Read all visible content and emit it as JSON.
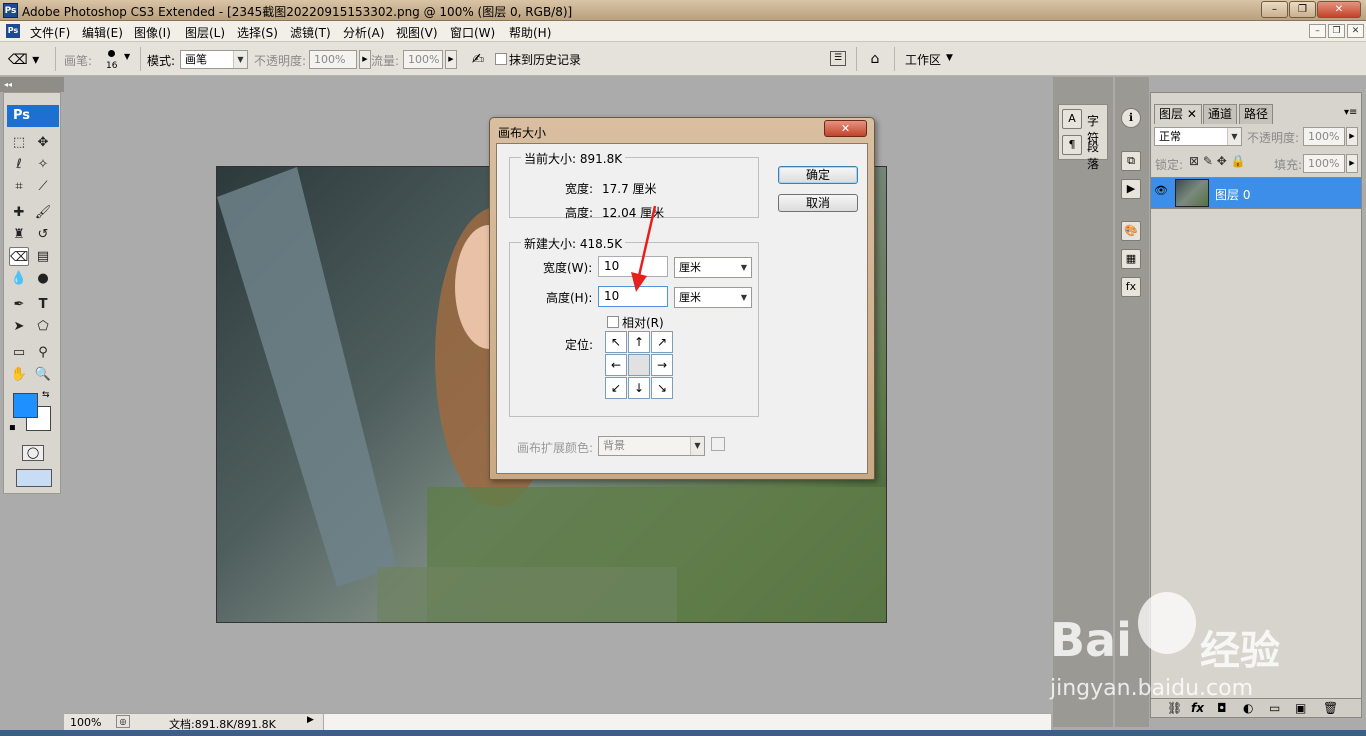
{
  "window": {
    "app_icon": "Ps",
    "title": "Adobe Photoshop CS3 Extended - [2345截图20220915153302.png @ 100% (图层 0, RGB/8)]",
    "controls": [
      "–",
      "❐",
      "✕"
    ]
  },
  "menubar": {
    "logo": "Ps",
    "items": [
      "文件(F)",
      "编辑(E)",
      "图像(I)",
      "图层(L)",
      "选择(S)",
      "滤镜(T)",
      "分析(A)",
      "视图(V)",
      "窗口(W)",
      "帮助(H)"
    ],
    "doc_controls": [
      "–",
      "❐",
      "✕"
    ]
  },
  "options": {
    "brush_label": "画笔:",
    "brush_size": "16",
    "mode_label": "模式:",
    "mode_value": "画笔",
    "opacity_label": "不透明度:",
    "opacity_value": "100%",
    "flow_label": "流量:",
    "flow_value": "100%",
    "erase_history_label": "抹到历史记录",
    "workspace_label": "工作区"
  },
  "toolbox": {
    "logo": "Ps",
    "foreground_color": "#1e90ff",
    "background_color": "#ffffff"
  },
  "status": {
    "zoom": "100%",
    "doc_info": "文档:891.8K/891.8K"
  },
  "dialog": {
    "title": "画布大小",
    "close": "✕",
    "current_size_label": "当前大小: 891.8K",
    "current_width_label": "宽度:",
    "current_width_value": "17.7 厘米",
    "current_height_label": "高度:",
    "current_height_value": "12.04 厘米",
    "new_size_label": "新建大小: 418.5K",
    "width_label": "宽度(W):",
    "width_value": "10",
    "width_unit": "厘米",
    "height_label": "高度(H):",
    "height_value": "10",
    "height_unit": "厘米",
    "relative_label": "相对(R)",
    "anchor_label": "定位:",
    "anchor_arrows": [
      "↖",
      "↑",
      "↗",
      "←",
      "",
      "→",
      "↙",
      "↓",
      "↘"
    ],
    "ext_color_label": "画布扩展颜色:",
    "ext_color_value": "背景",
    "ok_label": "确定",
    "cancel_label": "取消"
  },
  "dock": {
    "char_label": "字符",
    "para_label": "段落"
  },
  "layers": {
    "tabs": [
      "图层",
      "通道",
      "路径"
    ],
    "blend_mode": "正常",
    "opacity_label": "不透明度:",
    "opacity_value": "100%",
    "lock_label": "锁定:",
    "fill_label": "填充:",
    "fill_value": "100%",
    "layer_name": "图层 0",
    "footer_icons": [
      "⛓",
      "fx",
      "◘",
      "◐",
      "▭",
      "▣",
      "🗑"
    ]
  },
  "watermark": {
    "brand": "Bai",
    "brand_cn": "经验",
    "url": "jingyan.baidu.com"
  }
}
